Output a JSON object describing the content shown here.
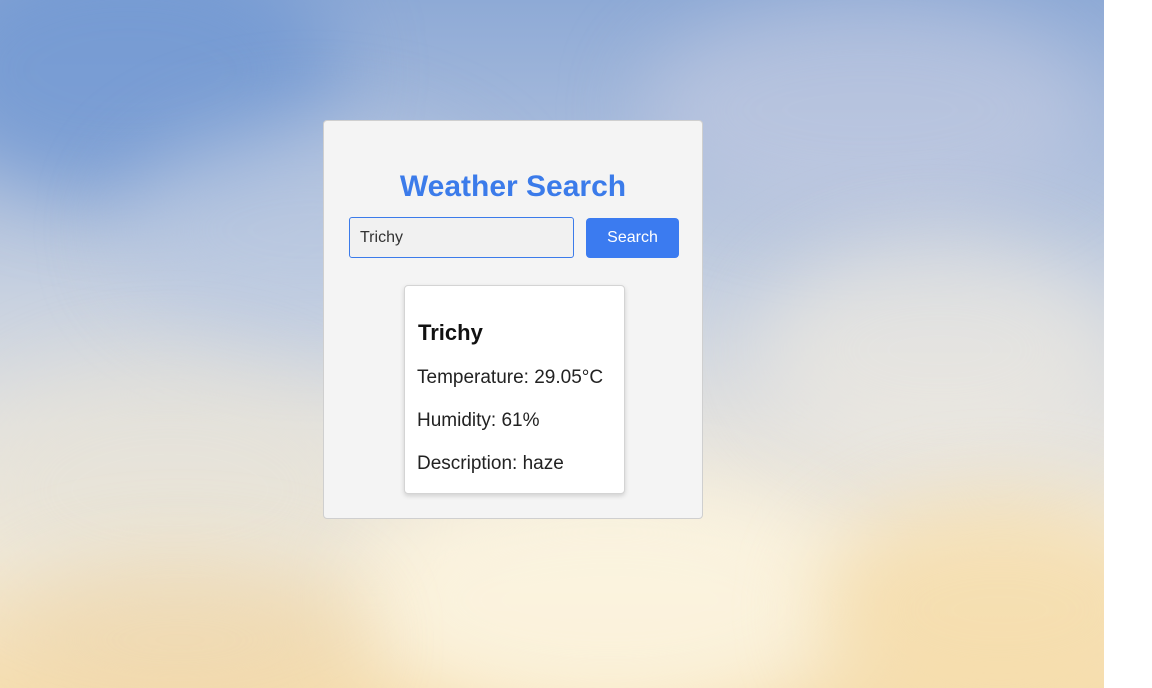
{
  "app": {
    "title": "Weather Search"
  },
  "search": {
    "value": "Trichy",
    "button_label": "Search"
  },
  "result": {
    "city": "Trichy",
    "temperature_text": "Temperature: 29.05°C",
    "humidity_text": "Humidity: 61%",
    "description_text": "Description: haze"
  },
  "colors": {
    "accent": "#3b7bea",
    "button": "#3b7bf0",
    "panel": "#f4f4f4",
    "card": "#ffffff"
  }
}
